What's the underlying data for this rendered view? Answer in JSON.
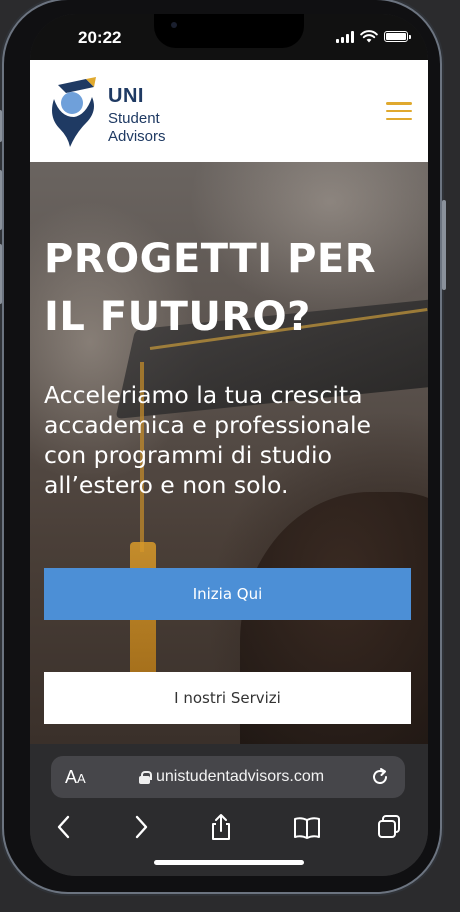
{
  "status_bar": {
    "time": "20:22"
  },
  "site": {
    "logo": {
      "line1": "UNI",
      "line2": "Student",
      "line3": "Advisors"
    },
    "colors": {
      "brand_navy": "#1f3a63",
      "accent_gold": "#e0a92e",
      "cta_blue": "#4c8fd6"
    }
  },
  "hero": {
    "title": "PROGETTI PER IL FUTURO?",
    "subtitle": "Acceleriamo la tua crescita accademica e professionale con programmi di studio all’estero e non solo.",
    "primary_cta": "Inizia Qui",
    "secondary_cta": "I nostri Servizi"
  },
  "browser": {
    "text_size_label": "A",
    "text_size_label_small": "A",
    "url": "unistudentadvisors.com",
    "icons": [
      "lock-icon",
      "reload-icon",
      "back-icon",
      "forward-icon",
      "share-icon",
      "bookmarks-icon",
      "tabs-icon"
    ]
  }
}
